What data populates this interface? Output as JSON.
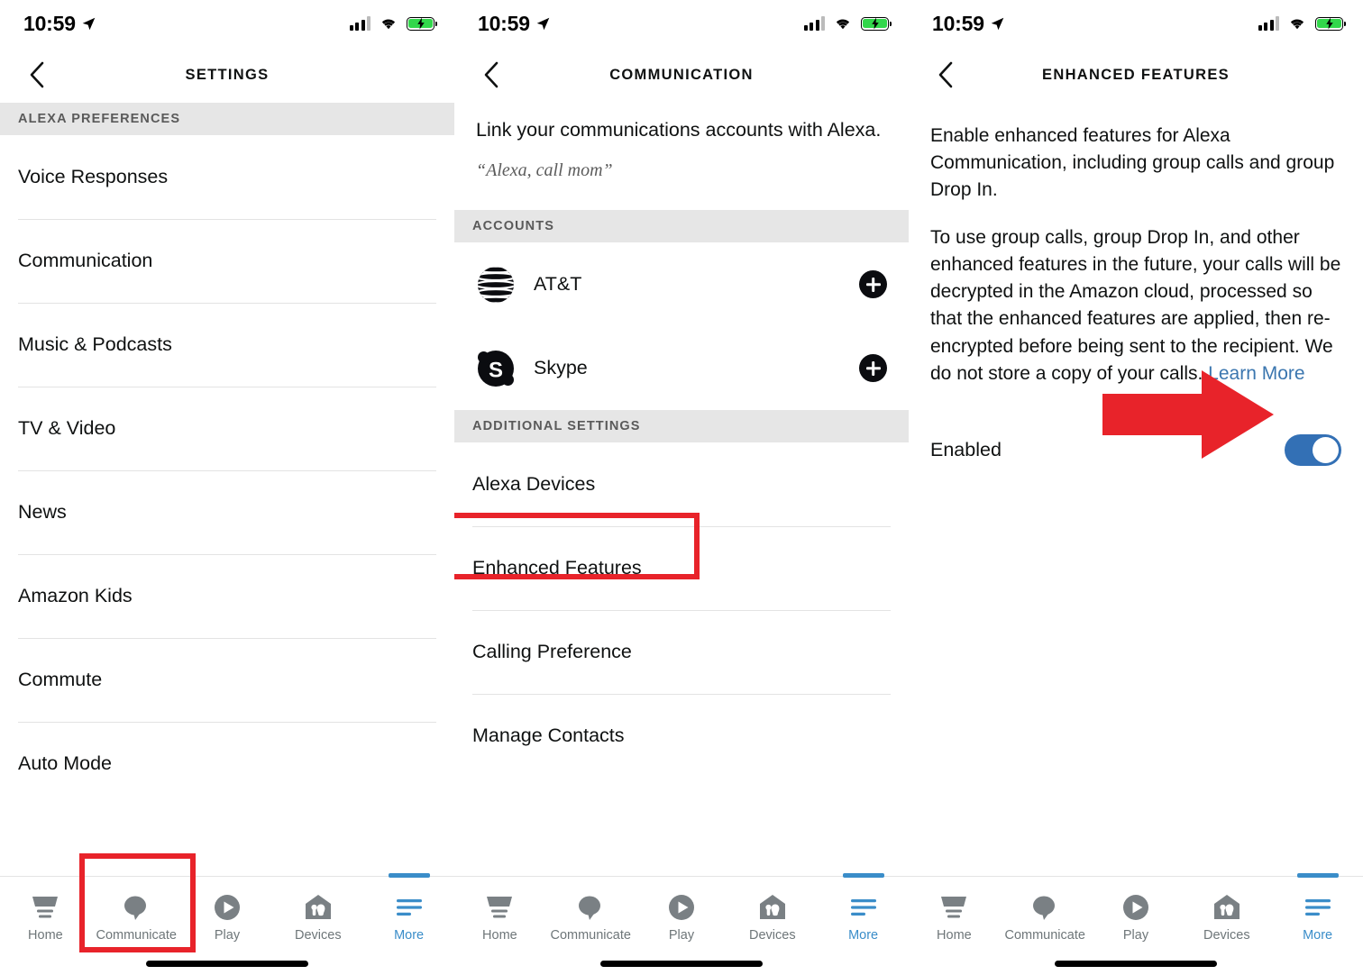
{
  "status_bar": {
    "time": "10:59",
    "icons": [
      "location-arrow-icon",
      "cellular-signal-icon",
      "wifi-icon",
      "battery-charging-icon"
    ]
  },
  "panel_settings": {
    "title": "SETTINGS",
    "back_label": "Back",
    "section_header": "ALEXA PREFERENCES",
    "items": [
      {
        "label": "Voice Responses"
      },
      {
        "label": "Communication"
      },
      {
        "label": "Music & Podcasts"
      },
      {
        "label": "TV & Video"
      },
      {
        "label": "News"
      },
      {
        "label": "Amazon Kids"
      },
      {
        "label": "Commute"
      },
      {
        "label": "Auto Mode"
      }
    ]
  },
  "panel_communication": {
    "title": "COMMUNICATION",
    "intro": "Link your communications accounts with Alexa.",
    "quote": "“Alexa, call mom”",
    "accounts_header": "ACCOUNTS",
    "accounts": [
      {
        "name": "AT&T",
        "icon": "att-logo-icon",
        "action": "add-icon"
      },
      {
        "name": "Skype",
        "icon": "skype-logo-icon",
        "action": "add-icon"
      }
    ],
    "additional_header": "ADDITIONAL SETTINGS",
    "additional_items": [
      {
        "label": "Alexa Devices"
      },
      {
        "label": "Enhanced Features"
      },
      {
        "label": "Calling Preference"
      },
      {
        "label": "Manage Contacts"
      }
    ]
  },
  "panel_enhanced_features": {
    "title": "ENHANCED FEATURES",
    "paragraph_1": "Enable enhanced features for Alexa Communication, including group calls and group Drop In.",
    "paragraph_2_text": "To use group calls, group Drop In, and other enhanced features in the future, your calls will be decrypted in the Amazon cloud, processed so that the enhanced features are applied, then re-encrypted before being sent to the recipient. We do not store a copy of your calls. ",
    "paragraph_2_link": "Learn More",
    "toggle_label": "Enabled",
    "toggle_state": "on"
  },
  "tab_bar": {
    "tabs": [
      {
        "label": "Home",
        "icon": "home-icon",
        "active": false
      },
      {
        "label": "Communicate",
        "icon": "speech-bubble-icon",
        "active": false
      },
      {
        "label": "Play",
        "icon": "play-circle-icon",
        "active": false
      },
      {
        "label": "Devices",
        "icon": "devices-house-icon",
        "active": false
      },
      {
        "label": "More",
        "icon": "hamburger-menu-icon",
        "active": true
      }
    ]
  },
  "annotations": {
    "highlight_color": "#e8232a",
    "boxes": [
      {
        "target": "Communicate"
      },
      {
        "target": "Enhanced Features"
      }
    ],
    "arrow": {
      "target": "Enabled toggle",
      "direction": "right"
    }
  },
  "colors": {
    "accent_blue": "#3a8dc9",
    "link_blue": "#3b76af",
    "toggle_on": "#3370b5",
    "annotation_red": "#e8232a",
    "section_bg": "#e6e6e6",
    "text": "#0f1111",
    "muted": "#6e7679"
  }
}
